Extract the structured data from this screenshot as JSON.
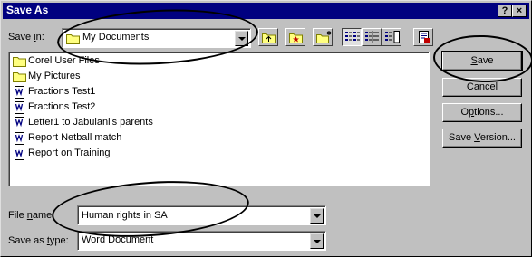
{
  "dialog": {
    "title": "Save As",
    "help_label": "?",
    "close_label": "×"
  },
  "save_in": {
    "label_pre": "Save ",
    "label_key": "i",
    "label_post": "n:",
    "value": "My Documents"
  },
  "toolbar": {
    "icons": [
      "up-one-level-icon",
      "look-in-favorites-icon",
      "create-new-folder-icon",
      "list-view-icon",
      "details-view-icon",
      "properties-view-icon",
      "commands-and-settings-icon"
    ]
  },
  "files": [
    {
      "name": "Corel User Files",
      "icon": "folder-icon"
    },
    {
      "name": "My Pictures",
      "icon": "folder-icon"
    },
    {
      "name": "Fractions Test1",
      "icon": "word-document-icon"
    },
    {
      "name": "Fractions Test2",
      "icon": "word-document-icon"
    },
    {
      "name": "Letter1 to Jabulani's parents",
      "icon": "word-document-icon"
    },
    {
      "name": "Report Netball match",
      "icon": "word-document-icon"
    },
    {
      "name": "Report on Training",
      "icon": "word-document-icon"
    }
  ],
  "buttons": {
    "save_pre": "",
    "save_key": "S",
    "save_post": "ave",
    "cancel": "Cancel",
    "options_pre": "O",
    "options_key": "p",
    "options_post": "tions...",
    "save_version_pre": "Save ",
    "save_version_key": "V",
    "save_version_post": "ersion..."
  },
  "file_name": {
    "label_pre": "File ",
    "label_key": "n",
    "label_post": "ame:",
    "value": "Human rights in SA"
  },
  "save_as_type": {
    "label_pre": "Save as ",
    "label_key": "t",
    "label_post": "ype:",
    "value": "Word Document"
  },
  "colors": {
    "titlebar": "#000080",
    "face": "#c0c0c0",
    "folder": "#ffff80",
    "ink": "#000000"
  }
}
